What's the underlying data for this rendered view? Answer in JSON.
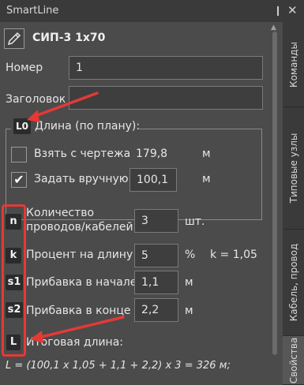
{
  "window": {
    "title": "SmartLine",
    "pin_glyph": "❙",
    "close_glyph": "✕"
  },
  "header": {
    "title": "СИП-3 1x70",
    "icon": "pencil-icon"
  },
  "fields": {
    "number_label": "Номер",
    "number_value": "1",
    "heading_label": "Заголовок",
    "heading_value": ""
  },
  "length_group": {
    "badge": "L0",
    "title": "Длина (по плану):",
    "from_drawing": {
      "label": "Взять с чертежа",
      "value": "179,8",
      "unit": "м",
      "checked": false
    },
    "manual": {
      "label": "Задать вручную",
      "value": "100,1",
      "unit": "м",
      "checked": true,
      "check_glyph": "✔"
    }
  },
  "params": [
    {
      "badge": "n",
      "label_line1": "Количество",
      "label_line2": "проводов/кабелей",
      "value": "3",
      "unit": "шт."
    },
    {
      "badge": "k",
      "label": "Процент на длину",
      "value": "5",
      "unit": "%",
      "extra": "k = 1,05"
    },
    {
      "badge": "s1",
      "label": "Прибавка в начале",
      "value": "1,1",
      "unit": "м"
    },
    {
      "badge": "s2",
      "label": "Прибавка в конце",
      "value": "2,2",
      "unit": "м"
    }
  ],
  "total": {
    "badge": "L",
    "label": "Итоговая длина:",
    "formula": "L = (100,1 x 1,05 + 1,1 + 2,2) x 3 = 326 м;"
  },
  "side_tabs": [
    {
      "label": "Команды",
      "active": false
    },
    {
      "label": "Типовые узлы",
      "active": false
    },
    {
      "label": "Кабель, провод",
      "active": false
    },
    {
      "label": "Свойства",
      "active": true
    }
  ],
  "annotation_color": "#e53935",
  "scroll_up_glyph": "▲"
}
